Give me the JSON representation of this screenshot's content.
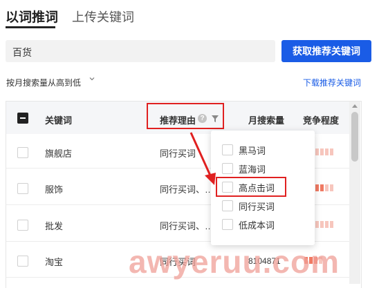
{
  "tabs": [
    {
      "label": "以词推词",
      "active": true
    },
    {
      "label": "上传关键词",
      "active": false
    }
  ],
  "search": {
    "value": "百货",
    "button_label": "获取推荐关键词"
  },
  "sort": {
    "label": "按月搜索量从高到低",
    "icon": "chevron-down-icon"
  },
  "download_link": "下载推荐关键词",
  "table": {
    "headers": {
      "keyword": "关键词",
      "reason": "推荐理由",
      "monthly_search": "月搜索量",
      "competition": "竞争程度"
    },
    "rows": [
      {
        "keyword": "旗舰店",
        "reason": "同行买词",
        "monthly_search": "",
        "competition_level": 0
      },
      {
        "keyword": "服饰",
        "reason": "同行买词、…",
        "monthly_search": "",
        "competition_level": 2
      },
      {
        "keyword": "批发",
        "reason": "同行买词、…",
        "monthly_search": "",
        "competition_level": 0
      },
      {
        "keyword": "淘宝",
        "reason": "同行买词",
        "monthly_search": "8104871",
        "competition_level": 3
      }
    ]
  },
  "filter_dropdown": {
    "options": [
      {
        "label": "黑马词",
        "checked": false
      },
      {
        "label": "蓝海词",
        "checked": false
      },
      {
        "label": "高点击词",
        "checked": false,
        "highlighted": true
      },
      {
        "label": "同行买词",
        "checked": false
      },
      {
        "label": "低成本词",
        "checked": false
      }
    ]
  },
  "watermark": "awyeruu.com",
  "colors": {
    "primary": "#1a5ce6",
    "highlight": "#e02020",
    "competition": "#f07a63"
  }
}
